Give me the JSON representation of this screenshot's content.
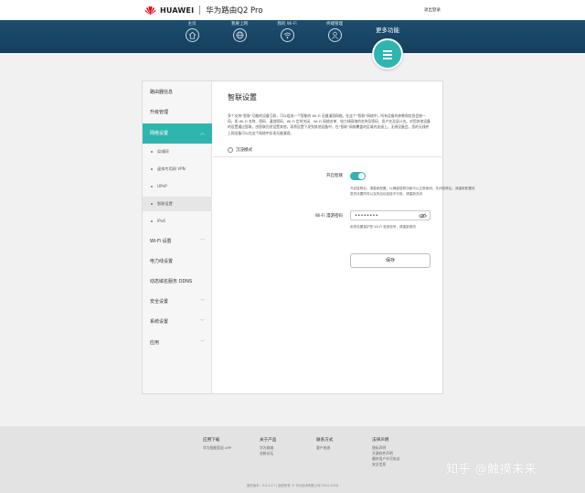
{
  "header": {
    "brand": "HUAWEI",
    "product": "华为路由Q2 Pro",
    "logout": "退出登录"
  },
  "nav": {
    "items": [
      {
        "label": "主页",
        "icon": "home-icon"
      },
      {
        "label": "我要上网",
        "icon": "globe-icon"
      },
      {
        "label": "我的 Wi-Fi",
        "icon": "wifi-icon"
      },
      {
        "label": "终端管理",
        "icon": "user-icon"
      }
    ],
    "more": {
      "label": "更多功能",
      "icon": "menu-icon"
    }
  },
  "sidebar": {
    "items": [
      {
        "label": "路由器信息"
      },
      {
        "label": "升级管理"
      },
      {
        "label": "网络设置"
      },
      {
        "label": "Wi-Fi 设置"
      },
      {
        "label": "电力线设置"
      },
      {
        "label": "动态域名服务 DDNS"
      },
      {
        "label": "安全设置"
      },
      {
        "label": "系统设置"
      },
      {
        "label": "应用"
      }
    ],
    "subitems": [
      {
        "label": "局域网"
      },
      {
        "label": "虚拟专用网 VPN"
      },
      {
        "label": "UPnP"
      },
      {
        "label": "智联设置"
      },
      {
        "label": "IPv6"
      }
    ]
  },
  "main": {
    "title": "智联设置",
    "description": "多个支持“智联”功能的设备互联，可以组成一个智能的 Wi-Fi 无缝漫游网络。在这个“智联”网络中，所有设备的参数和信息会统一同，如 Wi-Fi 名称、密码、漫游密码、Wi-Fi 定时关闭、Wi-Fi 网络名单、电力线网络的名称及密码、用户名及设计名。对您其他设备的设置通过智联，由智联仍然设置其他，再将设置下发到其他设备中。在“智联”网络覆盖的区域内连接上，无线设备会，您的无线终上网设备可以在这个网络中实现无缝漫游。",
    "collapse_label": "沉浸模式",
    "enable_label": "开启智联",
    "enable_desc": "开启智联后，请重新配置，以确保智联功能可以正常使用。关闭智联后，请重新配置信息的设置同时以及的自动连接不可用，请重新关闭",
    "enable_on": true,
    "pwd_label": "Wi-Fi 漫游密码",
    "pwd_value": "••••••••",
    "pwd_hint": "用来设置保护您 Wi-Fi 漫游信号，请重新更改",
    "save_label": "保存"
  },
  "footer": {
    "cols": [
      {
        "heading": "应用下载",
        "links": [
          "华为智能家居 APP"
        ]
      },
      {
        "heading": "关于产品",
        "links": [
          "华为商城",
          "花粉论坛"
        ]
      },
      {
        "heading": "联系方式",
        "links": [
          "客户热线"
        ]
      },
      {
        "heading": "法律声明",
        "links": [
          "隐私声明",
          "开源软件声明",
          "最终用户许可协议",
          "安全信息"
        ]
      }
    ],
    "bottom": "固件版本：9.0.2.17 | 版权所有 © 华为技术有限公司 2012-2018"
  },
  "watermark": "知乎 @触摸未来"
}
